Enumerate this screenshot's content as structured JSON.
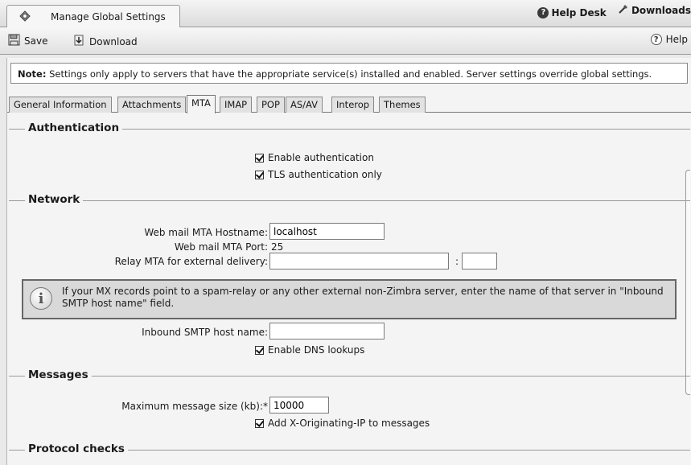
{
  "app": {
    "tab_title": "Manage Global Settings",
    "help_desk": "Help Desk",
    "downloads": "Downloads"
  },
  "toolbar": {
    "save": "Save",
    "download": "Download",
    "help": "Help"
  },
  "note": {
    "prefix": "Note:",
    "text": " Settings only apply to servers that have the appropriate service(s) installed and enabled. Server settings override global settings."
  },
  "tabs": [
    "General Information",
    "Attachments",
    "MTA",
    "IMAP",
    "POP",
    "AS/AV",
    "Interop",
    "Themes"
  ],
  "active_tab": "MTA",
  "sections": {
    "authentication": {
      "title": "Authentication",
      "enable_auth": "Enable authentication",
      "tls_only": "TLS authentication only"
    },
    "network": {
      "title": "Network",
      "hostname_label": "Web mail MTA Hostname:",
      "hostname_value": "localhost",
      "port_label": "Web mail MTA Port:",
      "port_value": "25",
      "relay_label": "Relay MTA for external delivery:",
      "relay_value": "",
      "relay_port_value": "",
      "colon": ":",
      "info_text": "If your MX records point to a spam-relay or any other external non-Zimbra server, enter the name of that server in \"Inbound SMTP host name\" field.",
      "inbound_label": "Inbound SMTP host name:",
      "inbound_value": "",
      "dns_lookups": "Enable DNS lookups"
    },
    "messages": {
      "title": "Messages",
      "max_size_label": "Maximum message size (kb):*",
      "max_size_value": "10000",
      "x_originating": "Add X-Originating-IP to messages"
    },
    "protocol_checks": {
      "title": "Protocol checks"
    }
  }
}
